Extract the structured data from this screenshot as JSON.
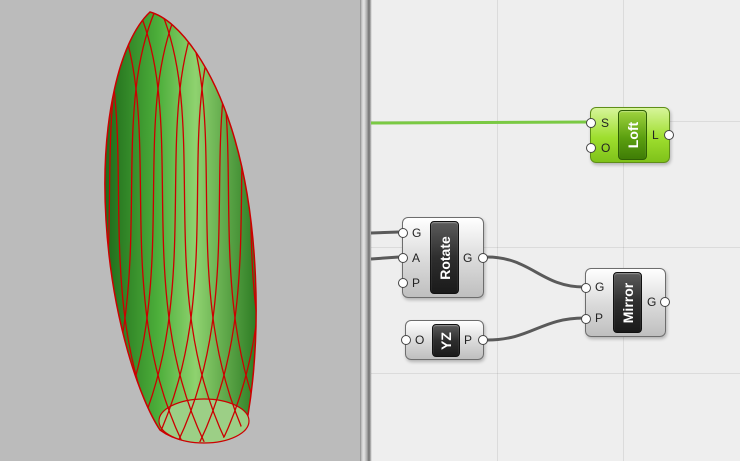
{
  "colors": {
    "wire_selected": "#7ac943",
    "wire": "#5a5a5a",
    "mesh_fill": "#2f8a26",
    "mesh_lines": "#cc0000",
    "canvas_bg": "#eeeeee"
  },
  "viewport": {
    "description_icon": "loft-mesh-preview"
  },
  "components": {
    "loft": {
      "title": "Loft",
      "inputs": [
        "S",
        "O"
      ],
      "outputs": [
        "L"
      ]
    },
    "rotate": {
      "title": "Rotate",
      "inputs": [
        "G",
        "A",
        "P"
      ],
      "outputs": [
        "G"
      ]
    },
    "yz": {
      "title": "YZ",
      "inputs": [
        "O"
      ],
      "outputs": [
        "P"
      ]
    },
    "mirror": {
      "title": "Mirror",
      "inputs": [
        "G",
        "P"
      ],
      "outputs": [
        "G"
      ]
    }
  }
}
